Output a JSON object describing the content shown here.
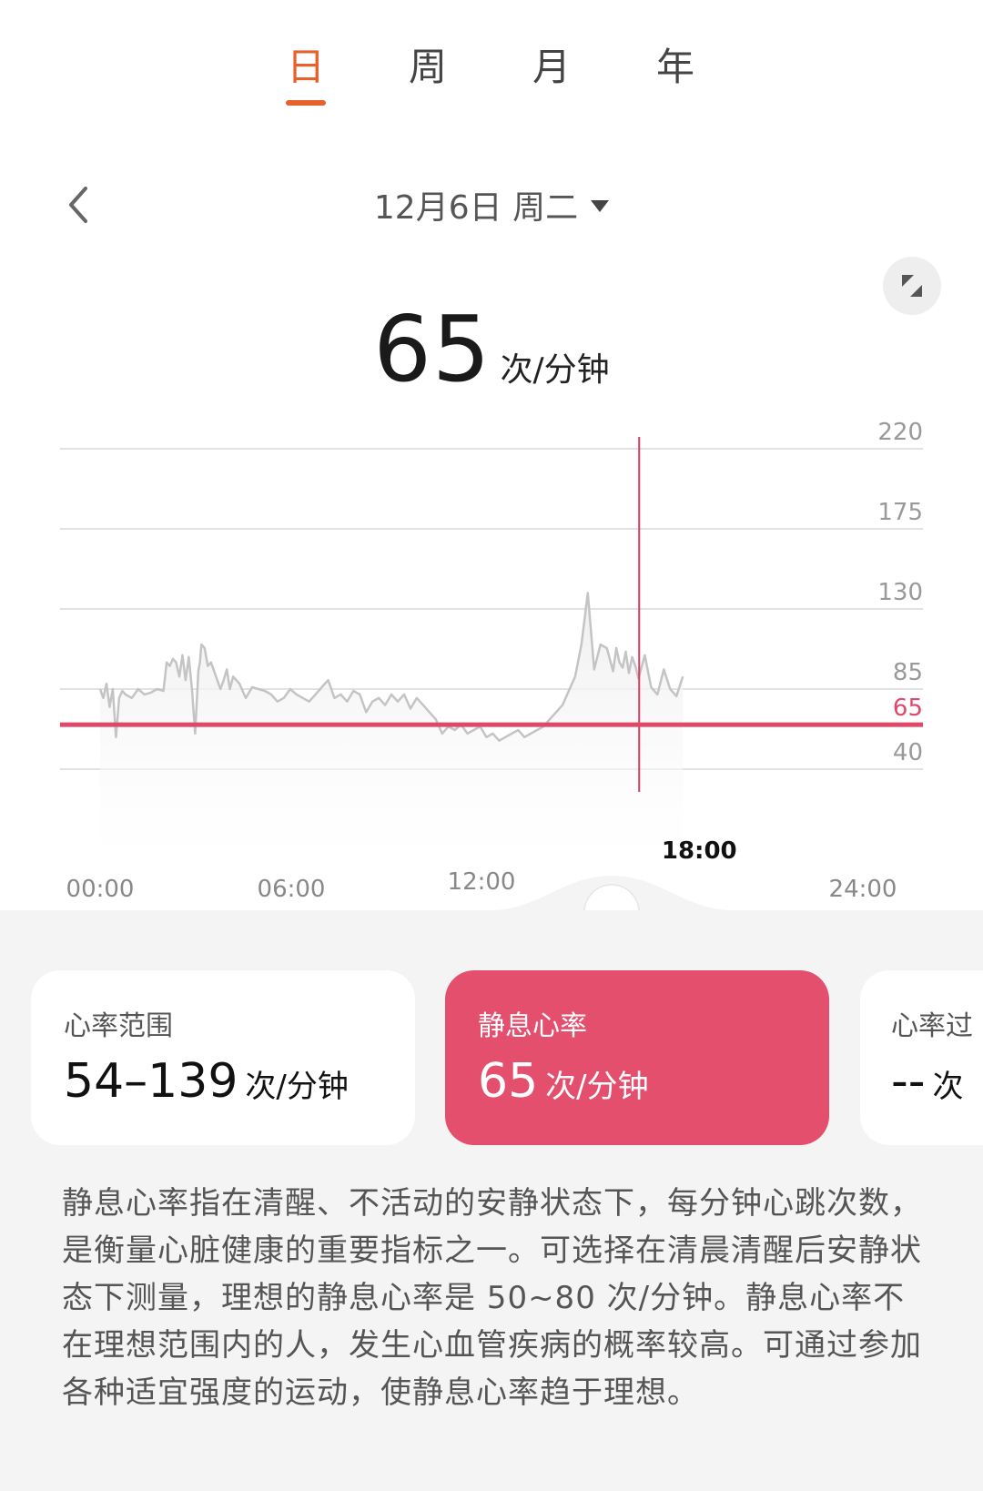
{
  "tabs": [
    {
      "label": "日",
      "active": true
    },
    {
      "label": "周",
      "active": false
    },
    {
      "label": "月",
      "active": false
    },
    {
      "label": "年",
      "active": false
    }
  ],
  "date": {
    "label": "12月6日 周二"
  },
  "current": {
    "value": "65",
    "unit": "次/分钟"
  },
  "chart_data": {
    "type": "line",
    "y_ticks": [
      "220",
      "175",
      "130",
      "85",
      "40"
    ],
    "x_ticks": [
      "00:00",
      "06:00",
      "12:00",
      "24:00"
    ],
    "selected_time": "18:00",
    "reference_line": {
      "label": "65",
      "value": 65,
      "color": "#e0486a"
    },
    "ylim": [
      0,
      220
    ],
    "series": [
      {
        "x": [
          0,
          0.1,
          0.2,
          0.3,
          0.4,
          0.5,
          0.6,
          0.7,
          0.8,
          1.0,
          1.2,
          1.4,
          1.6,
          1.8,
          2.0,
          2.1,
          2.2,
          2.3,
          2.4,
          2.5,
          2.6,
          2.7,
          2.8,
          2.9,
          3.0,
          3.1,
          3.15,
          3.2,
          3.3,
          3.4,
          3.5,
          3.6,
          3.7,
          3.8,
          3.9,
          4.0,
          4.1,
          4.2,
          4.4,
          4.6,
          4.8,
          5.0,
          5.2,
          5.4,
          5.6,
          5.8,
          6.0,
          6.2,
          6.4,
          6.6,
          6.8,
          7.0,
          7.2,
          7.4,
          7.6,
          7.8,
          8.0,
          8.2,
          8.4,
          8.6,
          8.8,
          9.0,
          9.2,
          9.4,
          9.6,
          9.8,
          10.0,
          10.2,
          10.4,
          10.6,
          10.8,
          11.0,
          11.2,
          11.4,
          11.6,
          11.8,
          12.0,
          12.2,
          12.4,
          12.6,
          12.8,
          13.0,
          13.2,
          13.4,
          13.6,
          13.8,
          14.0,
          14.2,
          14.4,
          14.6,
          14.8,
          15.0,
          15.2,
          15.4,
          15.6,
          15.8,
          16.0,
          16.2,
          16.3,
          16.4,
          16.5,
          16.6,
          16.7,
          16.8,
          16.9,
          17.0,
          17.2,
          17.4,
          17.6,
          17.8,
          18.0,
          18.2,
          18.4
        ],
        "values": [
          85,
          80,
          88,
          75,
          85,
          58,
          80,
          84,
          82,
          80,
          85,
          82,
          83,
          85,
          84,
          100,
          98,
          102,
          100,
          92,
          104,
          90,
          103,
          85,
          60,
          95,
          100,
          110,
          108,
          98,
          100,
          95,
          90,
          85,
          90,
          96,
          85,
          92,
          88,
          80,
          86,
          85,
          84,
          82,
          78,
          80,
          85,
          82,
          80,
          78,
          82,
          86,
          90,
          80,
          82,
          78,
          84,
          82,
          72,
          78,
          80,
          76,
          82,
          78,
          82,
          74,
          80,
          76,
          72,
          68,
          60,
          64,
          62,
          65,
          60,
          62,
          64,
          58,
          60,
          56,
          58,
          60,
          62,
          58,
          60,
          62,
          64,
          68,
          72,
          76,
          84,
          92,
          110,
          139,
          96,
          110,
          108,
          95,
          108,
          100,
          97,
          106,
          94,
          103,
          98,
          91,
          104,
          86,
          82,
          96,
          85,
          81,
          92
        ],
        "color": "#c4c4c4"
      }
    ]
  },
  "cards": [
    {
      "label": "心率范围",
      "value": "54–139",
      "unit": "次/分钟",
      "active": false
    },
    {
      "label": "静息心率",
      "value": "65",
      "unit": "次/分钟",
      "active": true
    },
    {
      "label": "心率过",
      "value": "--",
      "unit": "次",
      "active": false
    }
  ],
  "description": "静息心率指在清醒、不活动的安静状态下，每分钟心跳次数，是衡量心脏健康的重要指标之一。可选择在清晨清醒后安静状态下测量，理想的静息心率是 50~80 次/分钟。静息心率不在理想范围内的人，发生心血管疾病的概率较高。可通过参加各种适宜强度的运动，使静息心率趋于理想。",
  "colors": {
    "accent": "#e8602c",
    "heart": "#e54f6e",
    "line": "#c4c4c4"
  }
}
